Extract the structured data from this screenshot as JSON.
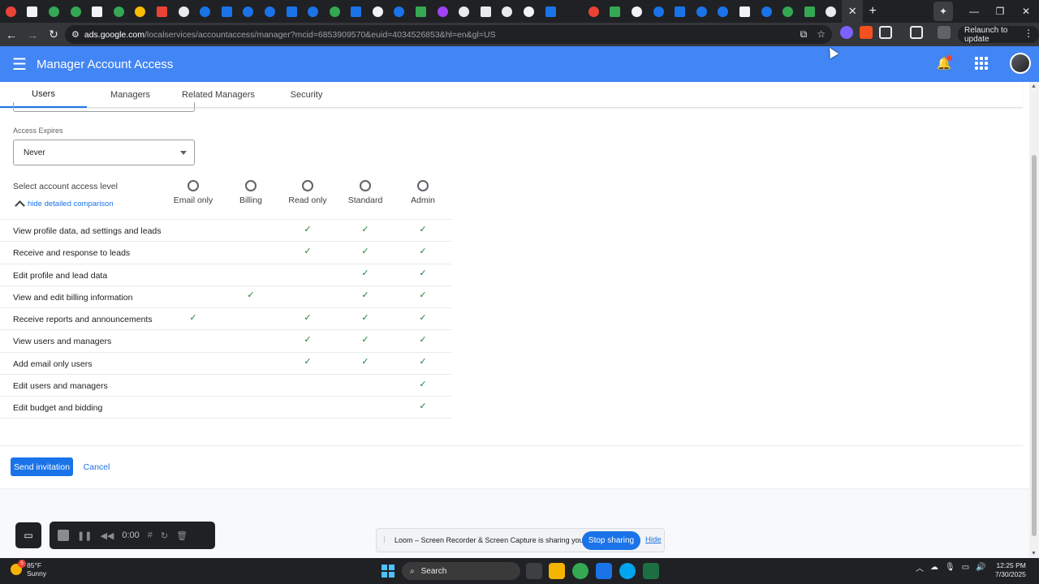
{
  "browser": {
    "tab_favicon_colors": [
      "#ea4335",
      "#f1f3f4",
      "#34a853",
      "#34a853",
      "#f1f3f4",
      "#34a853",
      "#fbbc05",
      "#ea4335",
      "#e8eaed",
      "#1a73e8",
      "#1a73e8",
      "#1a73e8",
      "#1a73e8",
      "#1a73e8",
      "#1a73e8",
      "#34a853",
      "#1a73e8",
      "#f1f3f4",
      "#1a73e8",
      "#34a853",
      "#a142f4",
      "#e8eaed",
      "#e8eaed",
      "#e8eaed",
      "#f1f3f4",
      "#1a73e8",
      "#202124",
      "#ea4335",
      "#34a853",
      "#f1f3f4",
      "#1a73e8",
      "#1a73e8",
      "#1a73e8",
      "#1a73e8",
      "#f1f3f4",
      "#1a73e8",
      "#34a853",
      "#34a853",
      "#e8eaed"
    ],
    "active_tab_close": "✕",
    "new_tab": "+",
    "address": {
      "host": "ads.google.com",
      "path": "/localservices/accountaccess/manager?mcid=6853909570&euid=4034526853&hl=en&gl=US"
    },
    "relaunch_label": "Relaunch to update"
  },
  "app": {
    "title": "Manager Account Access",
    "tabs": [
      {
        "label": "Users",
        "active": true
      },
      {
        "label": "Managers",
        "active": false
      },
      {
        "label": "Related Managers",
        "active": false
      },
      {
        "label": "Security",
        "active": false
      }
    ]
  },
  "form": {
    "access_expires_label": "Access Expires",
    "access_expires_value": "Never",
    "access_level_label": "Select account access level",
    "hide_comparison_label": "hide detailed comparison",
    "levels": [
      "Email only",
      "Billing",
      "Read only",
      "Standard",
      "Admin"
    ],
    "permissions": [
      {
        "feature": "View profile data, ad settings and leads",
        "levels": [
          false,
          false,
          true,
          true,
          true
        ]
      },
      {
        "feature": "Receive and response to leads",
        "levels": [
          false,
          false,
          true,
          true,
          true
        ]
      },
      {
        "feature": "Edit profile and lead data",
        "levels": [
          false,
          false,
          false,
          true,
          true
        ]
      },
      {
        "feature": "View and edit billing information",
        "levels": [
          false,
          true,
          false,
          true,
          true
        ]
      },
      {
        "feature": "Receive reports and announcements",
        "levels": [
          true,
          false,
          true,
          true,
          true
        ]
      },
      {
        "feature": "View users and managers",
        "levels": [
          false,
          false,
          true,
          true,
          true
        ]
      },
      {
        "feature": "Add email only users",
        "levels": [
          false,
          false,
          true,
          true,
          true
        ]
      },
      {
        "feature": "Edit users and managers",
        "levels": [
          false,
          false,
          false,
          false,
          true
        ]
      },
      {
        "feature": "Edit budget and bidding",
        "levels": [
          false,
          false,
          false,
          false,
          true
        ]
      }
    ],
    "check_glyph": "✓",
    "send_label": "Send invitation",
    "cancel_label": "Cancel"
  },
  "loom": {
    "timer": "0:00",
    "share_message": "Loom – Screen Recorder & Screen Capture is sharing your screen.",
    "stop_label": "Stop sharing",
    "hide_label": "Hide"
  },
  "taskbar": {
    "temperature": "85°F",
    "condition": "Sunny",
    "weather_badge": "5",
    "search_placeholder": "Search",
    "time": "12:25 PM",
    "date": "7/30/2025"
  }
}
